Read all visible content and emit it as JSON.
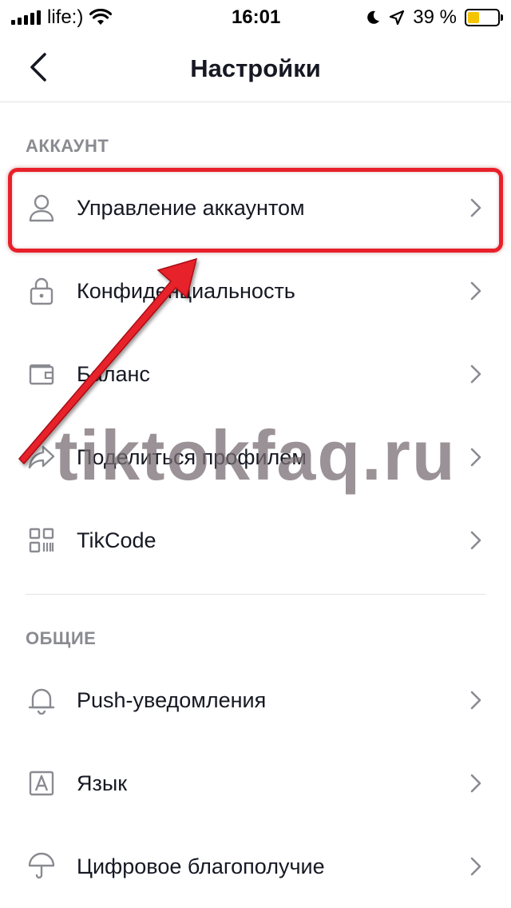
{
  "status_bar": {
    "carrier": "life:)",
    "time": "16:01",
    "battery_percent": "39 %",
    "battery_level": 0.39,
    "battery_color": "#f5c400"
  },
  "nav": {
    "title": "Настройки",
    "back_icon": "chevron-left-icon"
  },
  "sections": {
    "account": {
      "header": "АККАУНТ",
      "items": [
        {
          "label": "Управление аккаунтом",
          "icon": "person-icon"
        },
        {
          "label": "Конфиденциальность",
          "icon": "lock-icon"
        },
        {
          "label": "Баланс",
          "icon": "wallet-icon"
        },
        {
          "label": "Поделиться профилем",
          "icon": "share-icon"
        },
        {
          "label": "TikCode",
          "icon": "qr-code-icon"
        }
      ]
    },
    "general": {
      "header": "ОБЩИЕ",
      "items": [
        {
          "label": "Push-уведомления",
          "icon": "bell-icon"
        },
        {
          "label": "Язык",
          "icon": "language-icon"
        },
        {
          "label": "Цифровое благополучие",
          "icon": "umbrella-icon"
        }
      ]
    }
  },
  "overlay": {
    "watermark": "tiktokfaq.ru",
    "highlight_color": "#e8202a"
  }
}
